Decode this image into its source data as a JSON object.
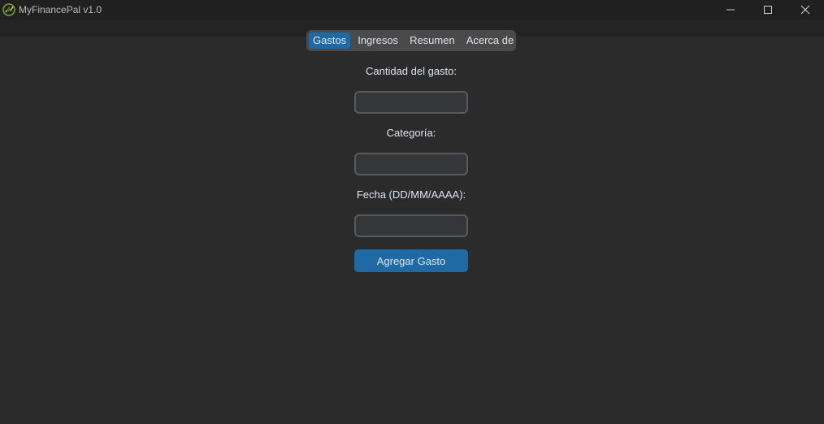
{
  "window": {
    "title": "MyFinancePal v1.0",
    "icon": "finance-leaf-icon"
  },
  "tabs": [
    {
      "label": "Gastos",
      "active": true
    },
    {
      "label": "Ingresos",
      "active": false
    },
    {
      "label": "Resumen",
      "active": false
    },
    {
      "label": "Acerca de",
      "active": false
    }
  ],
  "form": {
    "amount_label": "Cantidad del gasto:",
    "amount_value": "",
    "category_label": "Categoría:",
    "category_value": "",
    "date_label": "Fecha (DD/MM/AAAA):",
    "date_value": "",
    "submit_label": "Agregar Gasto"
  },
  "colors": {
    "background": "#2b2b2b",
    "accent": "#1f6aa5",
    "tab_bar": "#4a4a4a",
    "input_bg": "#343638",
    "input_border": "#565b5e"
  }
}
